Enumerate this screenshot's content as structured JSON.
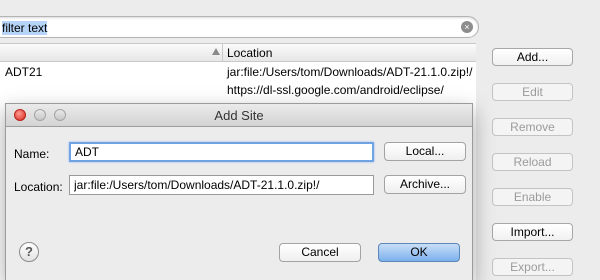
{
  "filter": {
    "value": "filter text",
    "clear_icon": "×"
  },
  "table": {
    "columns": [
      "",
      "Location"
    ],
    "rows": [
      {
        "name": "ADT21",
        "location": "jar:file:/Users/tom/Downloads/ADT-21.1.0.zip!/"
      },
      {
        "name": "",
        "location": "https://dl-ssl.google.com/android/eclipse/"
      }
    ]
  },
  "side_buttons": {
    "add": "Add...",
    "edit": "Edit",
    "remove": "Remove",
    "reload": "Reload",
    "enable": "Enable",
    "import": "Import...",
    "export": "Export..."
  },
  "dialog": {
    "title": "Add Site",
    "name_label": "Name:",
    "name_value": "ADT",
    "location_label": "Location:",
    "location_value": "jar:file:/Users/tom/Downloads/ADT-21.1.0.zip!/",
    "local_button": "Local...",
    "archive_button": "Archive...",
    "cancel_button": "Cancel",
    "ok_button": "OK",
    "help_icon": "?"
  }
}
